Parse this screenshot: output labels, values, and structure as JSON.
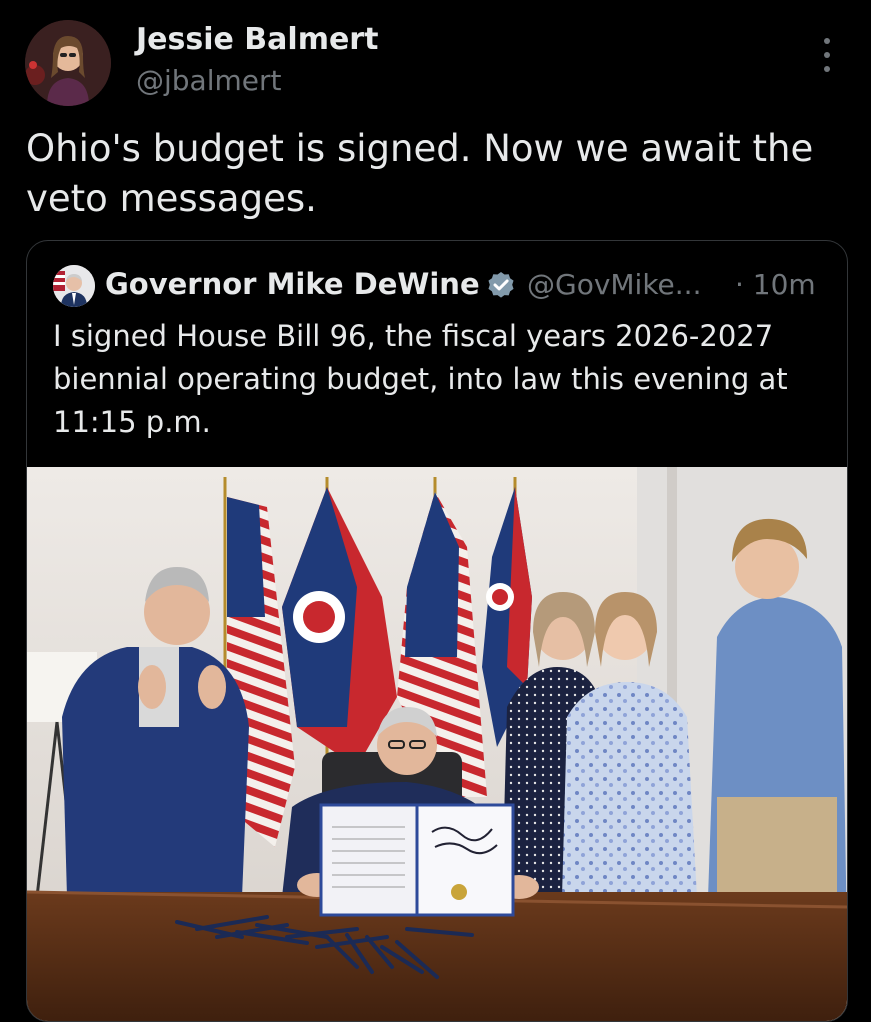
{
  "tweet": {
    "author_name": "Jessie Balmert",
    "author_handle": "@jbalmert",
    "text": "Ohio's budget is signed. Now we await the veto messages."
  },
  "quoted": {
    "author_name": "Governor Mike DeWine",
    "author_handle": "@GovMike...",
    "time": "· 10m",
    "text": "I signed House Bill 96, the fiscal years 2026-2027 biennial operating budget, into law this evening at 11:15 p.m."
  },
  "icons": {
    "more": "more-options-icon",
    "verified": "verified-badge-icon"
  },
  "colors": {
    "background": "#000000",
    "text_primary": "#e7e9ea",
    "text_secondary": "#71767b",
    "border": "#333639",
    "verified_badge": "#829aab"
  }
}
